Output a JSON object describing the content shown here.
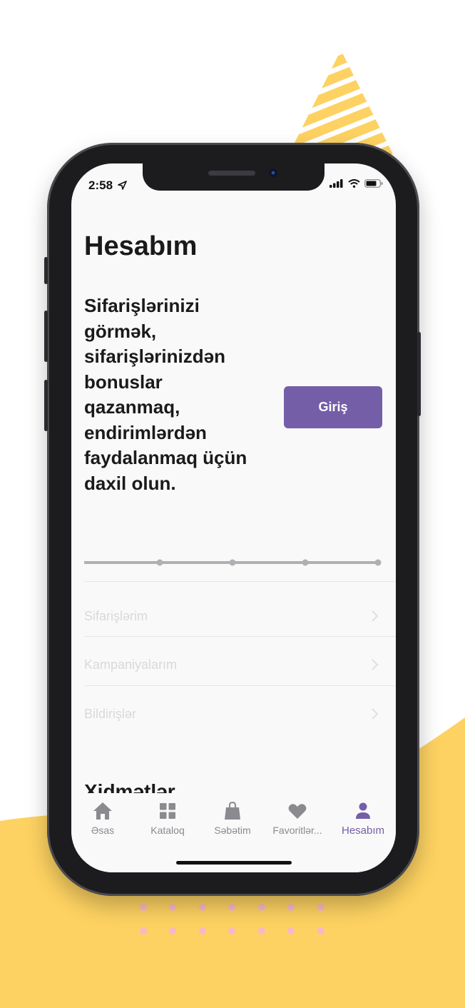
{
  "status_bar": {
    "time": "2:58"
  },
  "account": {
    "title": "Hesabım",
    "prompt": "Sifarişlərinizi görmək, sifarişlərinizdən bonuslar qazanmaq, endirimlərdən faydalanmaq üçün daxil olun.",
    "login_label": "Giriş"
  },
  "menu": [
    {
      "label": "Sifarişlərim",
      "icon": "chevron-right-icon"
    },
    {
      "label": "Kampaniyalarım",
      "icon": "chevron-right-icon"
    },
    {
      "label": "Bildirişlər",
      "icon": "chevron-right-icon"
    }
  ],
  "services": {
    "title": "Xidmətlər"
  },
  "tabs": [
    {
      "label": "Əsas",
      "icon": "home-icon",
      "active": false
    },
    {
      "label": "Kataloq",
      "icon": "grid-icon",
      "active": false
    },
    {
      "label": "Səbətim",
      "icon": "shopping-bag-icon",
      "active": false
    },
    {
      "label": "Favoritlər...",
      "icon": "heart-icon",
      "active": false
    },
    {
      "label": "Hesabım",
      "icon": "person-icon",
      "active": true
    }
  ],
  "colors": {
    "accent": "#745ea8",
    "background_yellow": "#fdd262",
    "inactive_tab": "#8a8a8f"
  }
}
